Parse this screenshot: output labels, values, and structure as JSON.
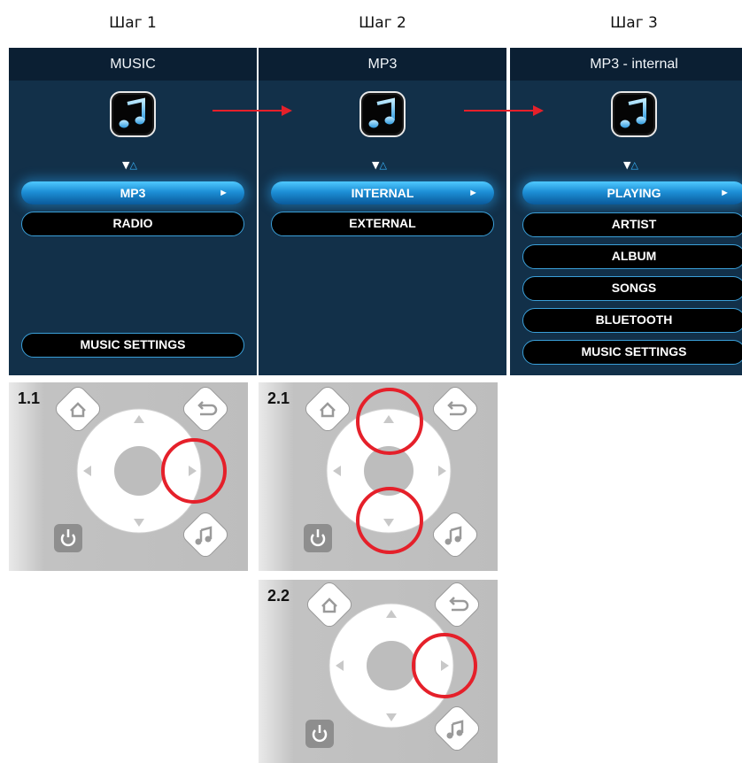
{
  "steps": [
    {
      "title": "Шаг 1",
      "screen": {
        "header": "MUSIC",
        "items": [
          {
            "label": "MP3",
            "selected": true
          },
          {
            "label": "RADIO",
            "selected": false
          }
        ],
        "bottom_item": "MUSIC SETTINGS"
      }
    },
    {
      "title": "Шаг 2",
      "screen": {
        "header": "MP3",
        "items": [
          {
            "label": "INTERNAL",
            "selected": true
          },
          {
            "label": "EXTERNAL",
            "selected": false
          }
        ]
      }
    },
    {
      "title": "Шаг 3",
      "screen": {
        "header": "MP3 - internal",
        "items": [
          {
            "label": "PLAYING",
            "selected": true
          },
          {
            "label": "ARTIST",
            "selected": false
          },
          {
            "label": "ALBUM",
            "selected": false
          },
          {
            "label": "SONGS",
            "selected": false
          },
          {
            "label": "BLUETOOTH",
            "selected": false
          },
          {
            "label": "MUSIC SETTINGS",
            "selected": false
          }
        ]
      }
    }
  ],
  "remotes": [
    {
      "label": "1.1",
      "highlight": [
        "right"
      ]
    },
    {
      "label": "2.1",
      "highlight": [
        "up",
        "down"
      ]
    },
    {
      "label": "2.2",
      "highlight": [
        "right"
      ]
    }
  ],
  "glyphs": {
    "scroll_down": "▼",
    "scroll_up": "△",
    "play": "►",
    "icon_names": [
      "music-note-icon",
      "home-icon",
      "back-icon",
      "power-icon"
    ]
  },
  "colors": {
    "screen_bg": "#123049",
    "header_bg": "#0b1f33",
    "selected_item": "#1d8fd6",
    "item_border": "#3a9fd8",
    "highlight_circle": "#e5202a",
    "flow_arrow": "#e5202a",
    "remote_bg": "#bdbdbd"
  }
}
